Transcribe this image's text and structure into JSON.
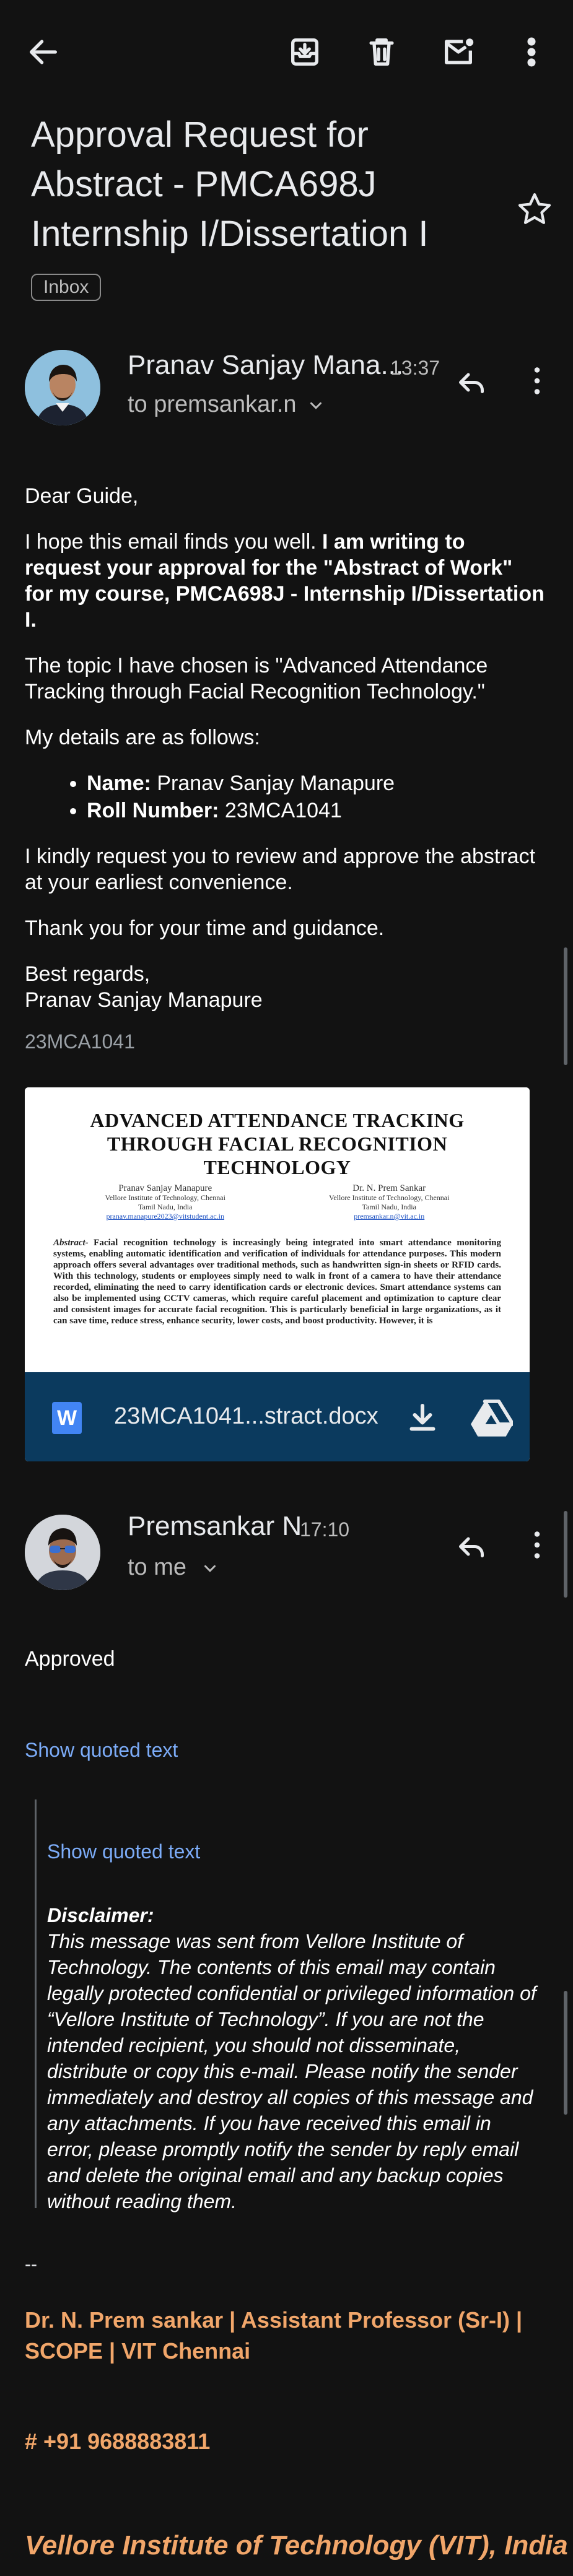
{
  "toolbar": {
    "icons": [
      "back-arrow-icon",
      "archive-icon",
      "delete-icon",
      "mark-unread-icon",
      "more-vertical-icon"
    ]
  },
  "email": {
    "subject": "Approval Request for Abstract - PMCA698J Internship I/Dissertation I",
    "label": "Inbox"
  },
  "message1": {
    "sender": "Pranav Sanjay Mana...",
    "time": "13:37",
    "to": "to premsankar.n",
    "greeting": "Dear Guide,",
    "p1_plain": "I hope this email finds you well. ",
    "p1_bold": "I am writing to request your approval for the \"Abstract of Work\" for my course, PMCA698J - Internship I/Dissertation I.",
    "p2": "The topic I have chosen is \"Advanced Attendance Tracking through Facial Recognition Technology.\"",
    "p3": "My details are as follows:",
    "details": [
      {
        "label": "Name:",
        "value": " Pranav Sanjay Manapure"
      },
      {
        "label": "Roll Number:",
        "value": " 23MCA1041"
      }
    ],
    "p4": "I kindly request you to review and approve the abstract at your earliest convenience.",
    "p5": "Thank you for your time and guidance.",
    "closing": "Best regards,",
    "closing_name": "Pranav Sanjay Manapure",
    "signature_code": "23MCA1041",
    "attachment": {
      "filename": "23MCA1041...stract.docx",
      "doc_title": "ADVANCED ATTENDANCE TRACKING THROUGH FACIAL RECOGNITION TECHNOLOGY",
      "author1_name": "Pranav Sanjay Manapure",
      "author1_affil": "Vellore Institute of Technology, Chennai",
      "author1_place": "Tamil Nadu, India",
      "author1_email": "pranav.manapure2023@vitstudent.ac.in",
      "author2_name": "Dr. N. Prem Sankar",
      "author2_affil": "Vellore Institute of Technology, Chennai",
      "author2_place": "Tamil Nadu, India",
      "author2_email": "premsankar.n@vit.ac.in",
      "abstract_label": "Abstract-",
      "abstract_text": " Facial recognition technology is increasingly being integrated into smart attendance monitoring systems, enabling automatic identification and verification of individuals for attendance purposes. This modern approach offers several advantages over traditional methods, such as handwritten sign-in sheets or RFID cards. With this technology, students or employees simply need to walk in front of a camera to have their attendance recorded, eliminating the need to carry identification cards or electronic devices. Smart attendance systems can also be implemented using CCTV cameras, which require careful placement and optimization to capture clear and consistent images for accurate facial recognition. This is particularly beneficial in large organizations, as it can save time, reduce stress, enhance security, lower costs, and boost productivity. However, it is"
    }
  },
  "message2": {
    "sender": "Premsankar N",
    "time": "17:10",
    "to": "to me",
    "body": "Approved",
    "show_quoted_1": "Show quoted text",
    "show_quoted_2": "Show quoted text",
    "disclaimer_title": "Disclaimer:",
    "disclaimer_text": "This message was sent from Vellore Institute of Technology.  The contents of this email may contain legally protected confidential or privileged information of “Vellore Institute of Technology”.  If you are not the intended recipient, you should not disseminate, distribute or copy this e-mail. Please notify the sender immediately and destroy all copies of this message and any attachments. If you have received this email in error, please promptly notify the sender by reply email and delete the original email and any backup copies without reading them.",
    "sig_dash": "--",
    "sig_title": "Dr. N. Prem sankar | Assistant Professor (Sr-I) | SCOPE | VIT Chennai",
    "sig_phone": "# +91 9688883811",
    "sig_org": "Vellore Institute of Technology (VIT), India"
  },
  "colors": {
    "background": "#121212",
    "link": "#7cacf8",
    "signature": "#f1a66a",
    "attachment_bar": "#0b3a5e"
  }
}
